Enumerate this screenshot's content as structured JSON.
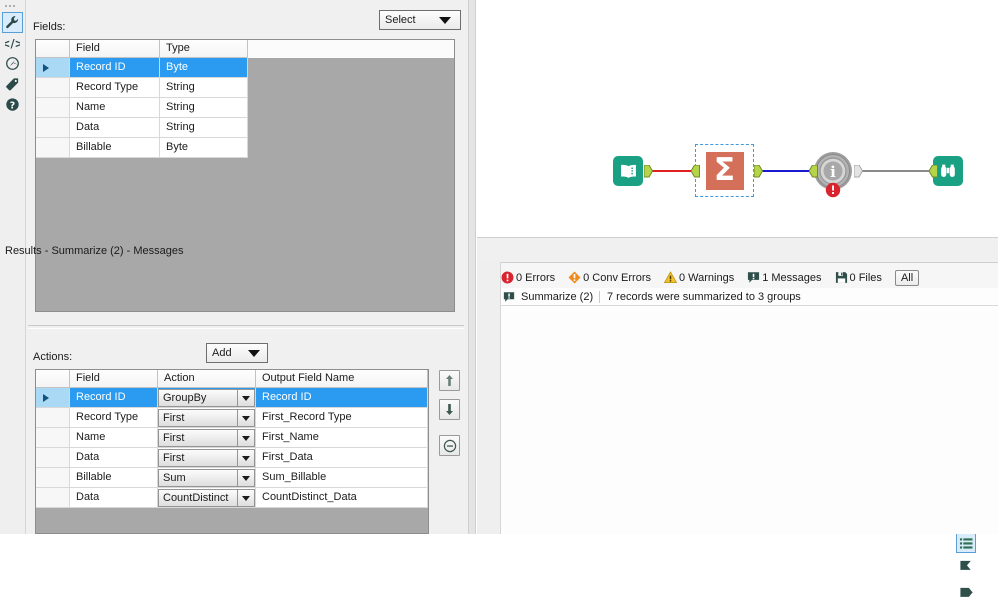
{
  "config_panel": {
    "fields_label": "Fields:",
    "select_dropdown": {
      "value": "Select"
    },
    "fields_table": {
      "columns": [
        "Field",
        "Type"
      ],
      "rows": [
        {
          "field": "Record ID",
          "type": "Byte",
          "selected": true
        },
        {
          "field": "Record Type",
          "type": "String",
          "selected": false
        },
        {
          "field": "Name",
          "type": "String",
          "selected": false
        },
        {
          "field": "Data",
          "type": "String",
          "selected": false
        },
        {
          "field": "Billable",
          "type": "Byte",
          "selected": false
        }
      ]
    },
    "actions_label": "Actions:",
    "add_dropdown": {
      "value": "Add"
    },
    "actions_table": {
      "columns": [
        "Field",
        "Action",
        "Output Field Name"
      ],
      "rows": [
        {
          "field": "Record ID",
          "action": "GroupBy",
          "output": "Record ID",
          "selected": true
        },
        {
          "field": "Record Type",
          "action": "First",
          "output": "First_Record Type",
          "selected": false
        },
        {
          "field": "Name",
          "action": "First",
          "output": "First_Name",
          "selected": false
        },
        {
          "field": "Data",
          "action": "First",
          "output": "First_Data",
          "selected": false
        },
        {
          "field": "Billable",
          "action": "Sum",
          "output": "Sum_Billable",
          "selected": false
        },
        {
          "field": "Data",
          "action": "CountDistinct",
          "output": "CountDistinct_Data",
          "selected": false
        }
      ]
    },
    "side_buttons": [
      {
        "name": "move-up",
        "icon": "arrow-up-icon"
      },
      {
        "name": "move-down",
        "icon": "arrow-down-icon"
      },
      {
        "name": "remove",
        "icon": "minus-circle-icon"
      }
    ],
    "icon_rail": [
      {
        "icon": "wrench-icon",
        "selected": true
      },
      {
        "icon": "code-icon",
        "selected": false
      },
      {
        "icon": "compass-icon",
        "selected": false
      },
      {
        "icon": "tag-icon",
        "selected": false
      },
      {
        "icon": "help-icon",
        "selected": false
      }
    ]
  },
  "canvas": {
    "nodes": [
      {
        "id": "input-data",
        "icon": "book-icon",
        "color": "#1aa184",
        "selected": false
      },
      {
        "id": "summarize",
        "icon": "sigma-icon",
        "color": "#d4705a",
        "selected": true
      },
      {
        "id": "gear-info",
        "icon": "gear-info-icon",
        "color": "#9e9e9e",
        "selected": false,
        "error_badge": true
      },
      {
        "id": "browse",
        "icon": "binoculars-icon",
        "color": "#1aa184",
        "selected": false
      }
    ],
    "connections": [
      {
        "from": "input-data",
        "to": "summarize",
        "color": "#e02020"
      },
      {
        "from": "summarize",
        "to": "gear-info",
        "color": "#1a1ad0"
      },
      {
        "from": "gear-info",
        "to": "browse",
        "color": "#8a8a8a"
      }
    ]
  },
  "results": {
    "title": "Results - Summarize (2) - Messages",
    "status": [
      {
        "icon": "error-icon",
        "label": "0 Errors",
        "color": "#d9232e"
      },
      {
        "icon": "conv-error-icon",
        "label": "0 Conv Errors",
        "color": "#ef8a1b"
      },
      {
        "icon": "warning-icon",
        "label": "0 Warnings",
        "color": "#f2c229"
      },
      {
        "icon": "message-icon",
        "label": "1 Messages",
        "color": "#2f4f4a"
      },
      {
        "icon": "file-icon",
        "label": "0 Files",
        "color": "#2f4f4a"
      }
    ],
    "filter_button": "All",
    "messages": [
      {
        "icon": "message-icon",
        "tool": "Summarize (2)",
        "text": "7 records were summarized to 3 groups"
      }
    ],
    "rail": [
      {
        "icon": "list-icon",
        "selected": true
      },
      {
        "icon": "pennant-icon",
        "selected": false
      },
      {
        "icon": "pennant2-icon",
        "selected": false
      }
    ]
  }
}
